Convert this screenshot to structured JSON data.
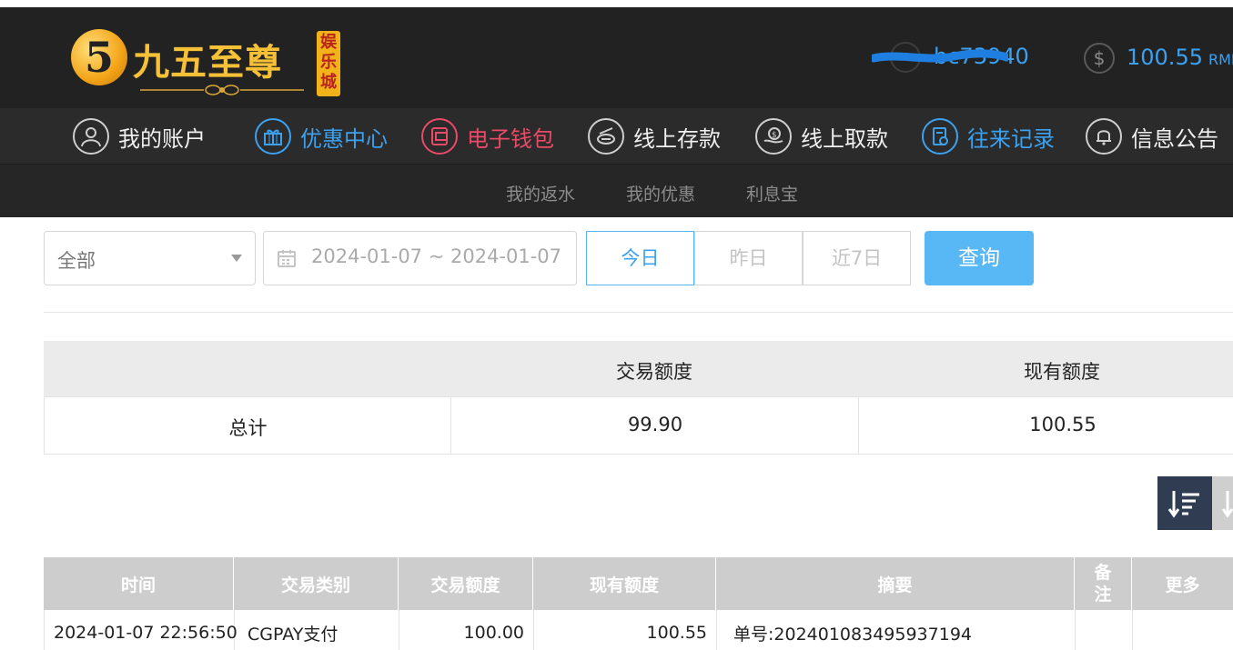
{
  "header": {
    "logo_text": "九五至尊",
    "logo_badge": "娱乐城",
    "logo_mark": "5",
    "username": "bc73940",
    "balance": "100.55",
    "currency": "RMB"
  },
  "nav": {
    "items": [
      {
        "label": "我的账户",
        "icon": "user-icon"
      },
      {
        "label": "优惠中心",
        "icon": "gift-icon"
      },
      {
        "label": "电子钱包",
        "icon": "wallet-icon"
      },
      {
        "label": "线上存款",
        "icon": "deposit-icon"
      },
      {
        "label": "线上取款",
        "icon": "withdraw-icon"
      },
      {
        "label": "往来记录",
        "icon": "records-icon"
      },
      {
        "label": "信息公告",
        "icon": "bell-icon"
      }
    ],
    "active_index": 5
  },
  "subnav": {
    "items": [
      "我的返水",
      "我的优惠",
      "利息宝"
    ]
  },
  "filter": {
    "type_value": "全部",
    "date_range": "2024-01-07 ~ 2024-01-07",
    "quick_ranges": [
      "今日",
      "昨日",
      "近7日"
    ],
    "query_label": "查询"
  },
  "summary": {
    "headers": [
      "",
      "交易额度",
      "现有额度"
    ],
    "row": [
      "总计",
      "99.90",
      "100.55"
    ]
  },
  "records": {
    "headers": [
      "时间",
      "交易类别",
      "交易额度",
      "现有额度",
      "摘要",
      "备注",
      "更多"
    ],
    "rows": [
      [
        "2024-01-07 22:56:50",
        "CGPAY支付",
        "100.00",
        "100.55",
        "单号:202401083495937194",
        "",
        ""
      ]
    ]
  },
  "colors": {
    "accent_blue": "#3ba1f0",
    "accent_red": "#e84a67",
    "logo_gold": "#f6c037",
    "header_bg": "#222222"
  }
}
